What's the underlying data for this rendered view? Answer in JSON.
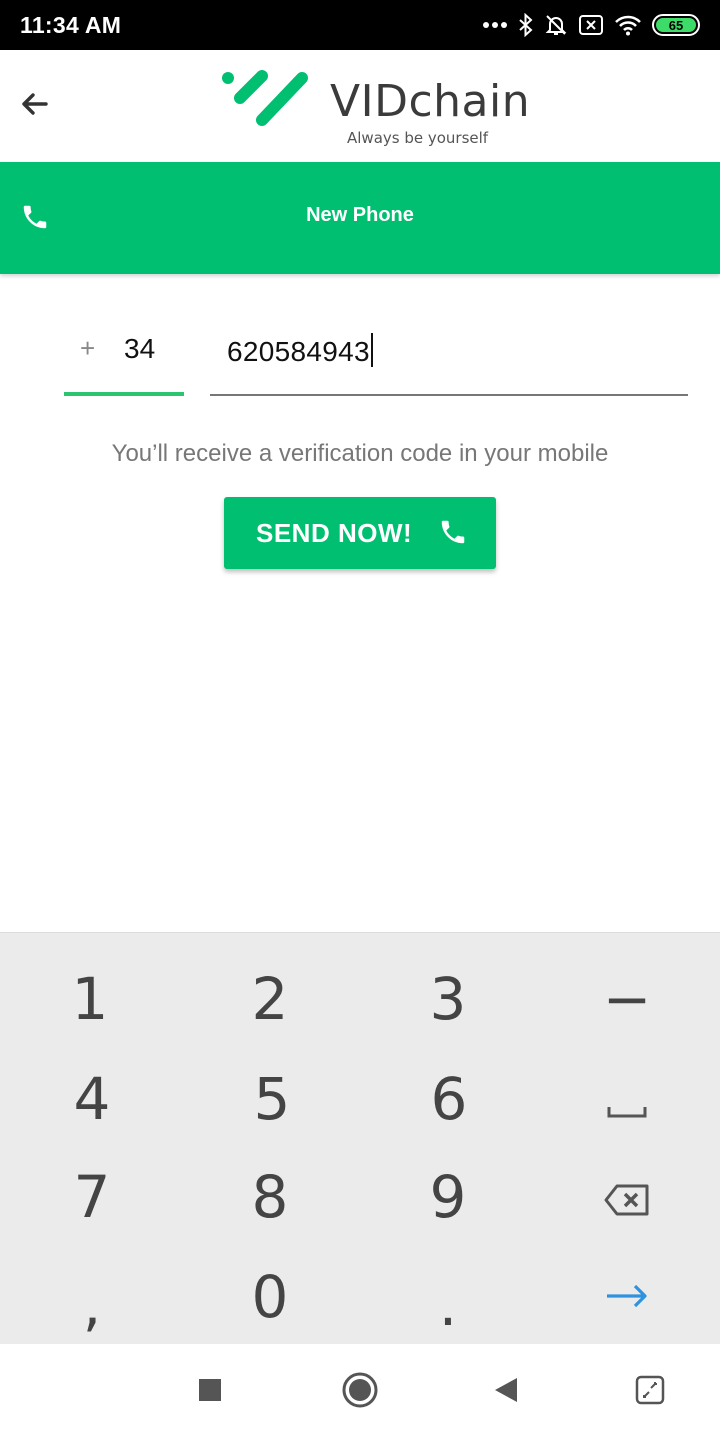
{
  "status_bar": {
    "time": "11:34 AM",
    "battery_level": "65",
    "icons": [
      "more-dots-icon",
      "bluetooth-icon",
      "notifications-off-icon",
      "sim-off-icon",
      "wifi-icon",
      "battery-icon"
    ]
  },
  "header": {
    "back_icon": "arrow-left-icon",
    "logo_text": "VIDchain",
    "logo_tagline": "Always be yourself",
    "logo_color": "#00bf71"
  },
  "toolbar": {
    "title": "New Phone",
    "icon": "phone-icon",
    "background": "#00bf71"
  },
  "form": {
    "plus": "+",
    "country_code": "34",
    "phone_number": "620584943",
    "hint": "You’ll receive a verification code in your mobile",
    "send_label": "SEND NOW!"
  },
  "keyboard": {
    "keys": [
      "1",
      "2",
      "3",
      "−",
      "4",
      "5",
      "6",
      "␣",
      "7",
      "8",
      "9",
      "⌫",
      ",",
      "0",
      ".",
      "→"
    ]
  },
  "nav_bar": {
    "icons": [
      "recents-square-icon",
      "home-circle-icon",
      "back-triangle-icon",
      "screen-rotate-icon"
    ]
  }
}
